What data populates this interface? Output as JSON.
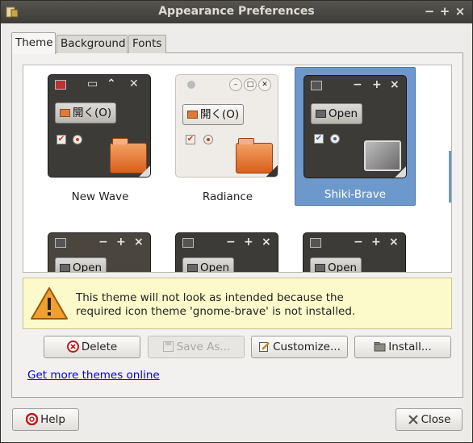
{
  "window": {
    "title": "Appearance Preferences",
    "controls": {
      "minimize": "−",
      "maximize": "+",
      "close": "×"
    }
  },
  "tabs": [
    {
      "label": "Theme",
      "active": true
    },
    {
      "label": "Background",
      "active": false
    },
    {
      "label": "Fonts",
      "active": false
    }
  ],
  "themes": [
    {
      "name": "New Wave",
      "selected": false,
      "open_label": "開く(O)"
    },
    {
      "name": "Radiance",
      "selected": false,
      "open_label": "開く(O)"
    },
    {
      "name": "Shiki-Brave",
      "selected": true,
      "open_label": "Open"
    },
    {
      "name": "",
      "selected": false,
      "open_label": "Open"
    },
    {
      "name": "",
      "selected": false,
      "open_label": "Open"
    },
    {
      "name": "",
      "selected": false,
      "open_label": "Open"
    }
  ],
  "warning": {
    "line1": "This theme will not look as intended because the",
    "line2": "required icon theme 'gnome-brave' is not installed."
  },
  "actions": {
    "delete": "Delete",
    "save_as": "Save As...",
    "customize": "Customize...",
    "install": "Install..."
  },
  "link_text": "Get more themes online",
  "footer": {
    "help": "Help",
    "close": "Close"
  },
  "colors": {
    "selection": "#6d98cc",
    "warning_bg": "#fcfaca",
    "link": "#0000ee"
  }
}
